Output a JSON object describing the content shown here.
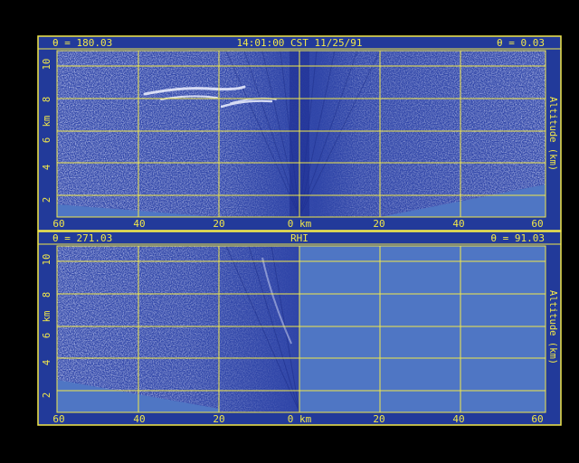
{
  "colors": {
    "background": "#000000",
    "frame": "#223a9a",
    "gridline": "#f2e84a",
    "label": "#f2e84a",
    "data_field": "#2f45a8",
    "noise": "#b9c2ee",
    "ground": "#4f76c4"
  },
  "top_panel": {
    "left_angle": "θ = 180.03",
    "title": "14:01:00 CST 11/25/91",
    "right_angle": "θ = 0.03",
    "y_axis_label_left": "km",
    "y_axis_label_right": "Altitude (km)",
    "y_ticks": [
      "2",
      "4",
      "6",
      "8",
      "10"
    ],
    "x_ticks": [
      "60",
      "40",
      "20",
      "0 km",
      "20",
      "40",
      "60"
    ]
  },
  "bottom_panel": {
    "left_angle": "θ = 271.03",
    "title": "RHI",
    "right_angle": "θ = 91.03",
    "y_axis_label_left": "km",
    "y_axis_label_right": "Altitude (km)",
    "y_ticks": [
      "2",
      "4",
      "6",
      "8",
      "10"
    ],
    "x_ticks": [
      "60",
      "40",
      "20",
      "0 km",
      "20",
      "40",
      "60"
    ]
  }
}
